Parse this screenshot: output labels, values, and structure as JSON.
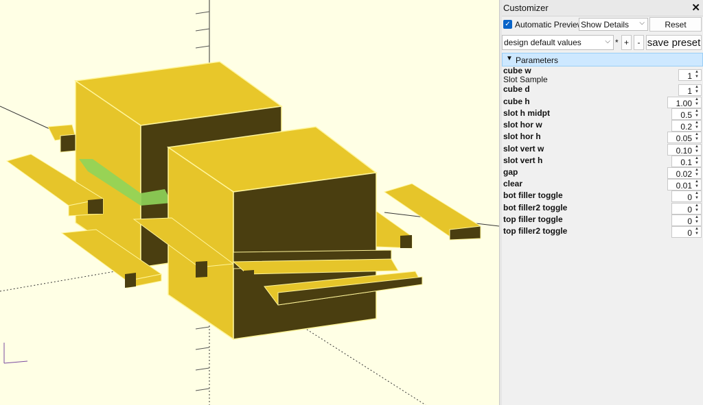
{
  "customizer": {
    "title": "Customizer",
    "close_glyph": "✕",
    "automatic_preview_label": "Automatic Preview",
    "automatic_preview_checked": true,
    "details_select": "Show Details",
    "reset_label": "Reset",
    "preset_select": "design default values",
    "preset_star": "*",
    "preset_add": "+",
    "preset_remove": "-",
    "save_preset_label": "save preset",
    "parameters_header": "Parameters"
  },
  "params": [
    {
      "name": "cube w",
      "desc": "Slot Sample",
      "value": "1"
    },
    {
      "name": "cube d",
      "value": "1"
    },
    {
      "name": "cube h",
      "value": "1.00"
    },
    {
      "name": "slot h midpt",
      "value": "0.5"
    },
    {
      "name": "slot hor w",
      "value": "0.2"
    },
    {
      "name": "slot hor h",
      "value": "0.05"
    },
    {
      "name": "slot vert w",
      "value": "0.10"
    },
    {
      "name": "slot vert h",
      "value": "0.1"
    },
    {
      "name": "gap",
      "value": "0.02"
    },
    {
      "name": "clear",
      "value": "0.01"
    },
    {
      "name": "bot filler toggle",
      "value": "0"
    },
    {
      "name": "bot filler2 toggle",
      "value": "0"
    },
    {
      "name": "top filler toggle",
      "value": "0"
    },
    {
      "name": "top filler2 toggle",
      "value": "0"
    }
  ],
  "colors": {
    "viewport_bg": "#ffffe5",
    "model_yellow": "#e8c72a",
    "model_dark": "#4a3e10",
    "highlight_green": "#8fd45a",
    "accent_blue": "#0a64c8"
  }
}
